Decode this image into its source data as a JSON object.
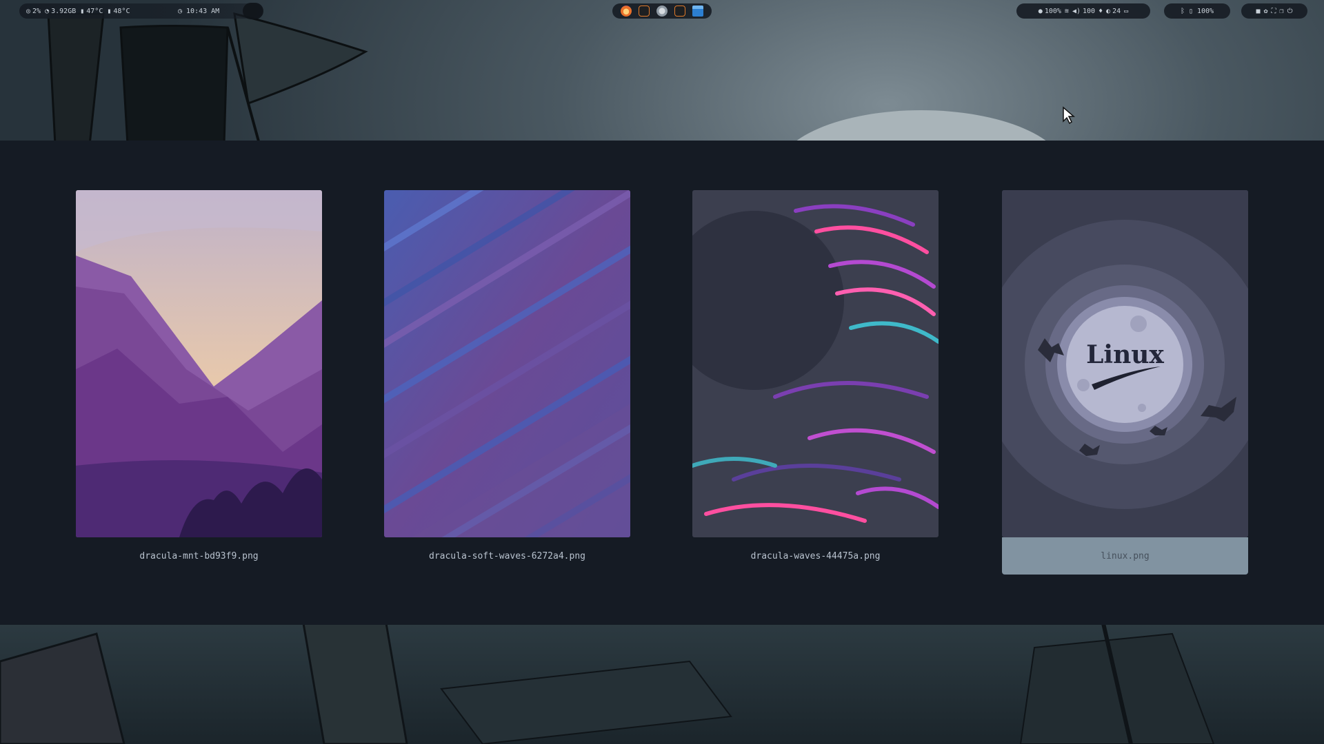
{
  "topbar": {
    "system": {
      "cpu": "2%",
      "memory": "3.92GB",
      "cpu_temp": "47°C",
      "gpu_temp": "48°C",
      "clock": "10:43 AM"
    },
    "apps": [
      "firefox",
      "terminal",
      "chromium",
      "terminal-2",
      "file-manager"
    ],
    "status": {
      "brightness": "100%",
      "volume": "100",
      "mic": "",
      "night_light": "24"
    },
    "bluetooth": {
      "battery": "100%"
    }
  },
  "picker": {
    "wallpapers": [
      {
        "filename": "dracula-mnt-bd93f9.png",
        "selected": false
      },
      {
        "filename": "dracula-soft-waves-6272a4.png",
        "selected": false
      },
      {
        "filename": "dracula-waves-44475a.png",
        "selected": false
      },
      {
        "filename": "linux.png",
        "selected": true,
        "logo_text": "Linux"
      }
    ]
  },
  "colors": {
    "panel_bg": "#151b24",
    "selected_caption_bg": "#8193a1",
    "caption_text": "#b9c3cf"
  }
}
